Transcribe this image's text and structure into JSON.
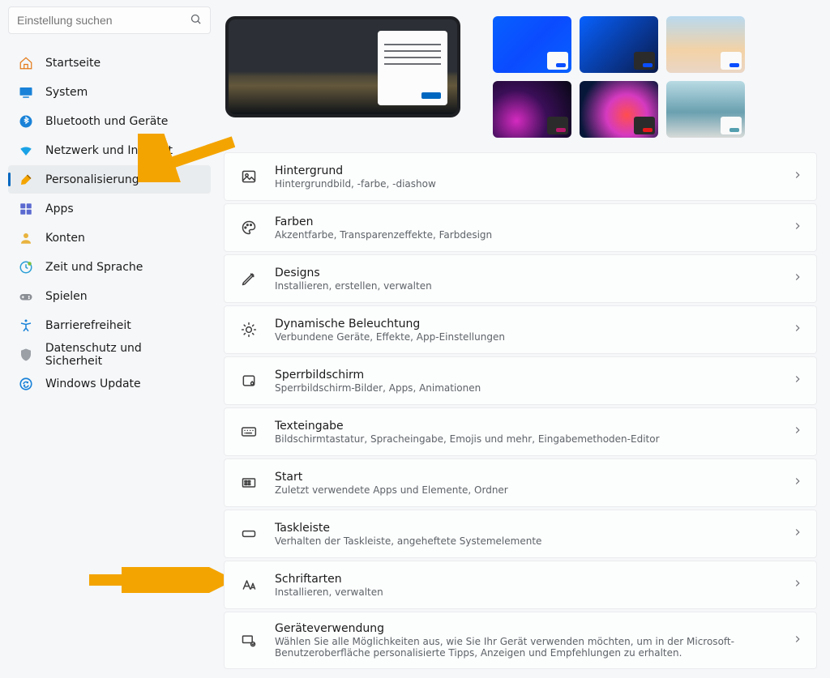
{
  "search": {
    "placeholder": "Einstellung suchen"
  },
  "nav": {
    "items": [
      {
        "label": "Startseite",
        "icon": "home"
      },
      {
        "label": "System",
        "icon": "system"
      },
      {
        "label": "Bluetooth und Geräte",
        "icon": "bluetooth"
      },
      {
        "label": "Netzwerk und Internet",
        "icon": "wifi"
      },
      {
        "label": "Personalisierung",
        "icon": "brush",
        "active": true
      },
      {
        "label": "Apps",
        "icon": "apps"
      },
      {
        "label": "Konten",
        "icon": "person"
      },
      {
        "label": "Zeit und Sprache",
        "icon": "clock"
      },
      {
        "label": "Spielen",
        "icon": "game"
      },
      {
        "label": "Barrierefreiheit",
        "icon": "a11y"
      },
      {
        "label": "Datenschutz und Sicherheit",
        "icon": "shield"
      },
      {
        "label": "Windows Update",
        "icon": "update"
      }
    ]
  },
  "cards": [
    {
      "title": "Hintergrund",
      "sub": "Hintergrundbild, -farbe, -diashow",
      "icon": "picture"
    },
    {
      "title": "Farben",
      "sub": "Akzentfarbe, Transparenzeffekte, Farbdesign",
      "icon": "palette"
    },
    {
      "title": "Designs",
      "sub": "Installieren, erstellen, verwalten",
      "icon": "pen"
    },
    {
      "title": "Dynamische Beleuchtung",
      "sub": "Verbundene Geräte, Effekte, App-Einstellungen",
      "icon": "light"
    },
    {
      "title": "Sperrbildschirm",
      "sub": "Sperrbildschirm-Bilder, Apps, Animationen",
      "icon": "lock"
    },
    {
      "title": "Texteingabe",
      "sub": "Bildschirmtastatur, Spracheingabe, Emojis und mehr, Eingabemethoden-Editor",
      "icon": "keyboard"
    },
    {
      "title": "Start",
      "sub": "Zuletzt verwendete Apps und Elemente, Ordner",
      "icon": "start"
    },
    {
      "title": "Taskleiste",
      "sub": "Verhalten der Taskleiste, angeheftete Systemelemente",
      "icon": "taskbar"
    },
    {
      "title": "Schriftarten",
      "sub": "Installieren, verwalten",
      "icon": "fonts"
    },
    {
      "title": "Geräteverwendung",
      "sub": "Wählen Sie alle Möglichkeiten aus, wie Sie Ihr Gerät verwenden möchten, um in der Microsoft-Benutzeroberfläche personalisierte Tipps, Anzeigen und Empfehlungen zu erhalten.",
      "icon": "device"
    }
  ],
  "thumbs": [
    {
      "bg": "linear-gradient(135deg,#0761ff 0%, #0b4bff 50%, #0761ff 100%)",
      "accent": "#0a4eff"
    },
    {
      "bg": "linear-gradient(135deg,#0761ff 0%, #0a1a4a 100%)",
      "accent": "#0a4eff",
      "dark": true
    },
    {
      "bg": "linear-gradient(180deg,#b9d9ef 0%, #f3d2a6 60%, #ead6c6 100%)",
      "accent": "#0a4eff"
    },
    {
      "bg": "radial-gradient(circle at 30% 70%, #d52bc0 0%, #3a0e57 45%, #070715 100%)",
      "accent": "#b5196a",
      "dark": true
    },
    {
      "bg": "radial-gradient(circle at 60% 60%, #ff4e4e 0%, #d63ac0 35%, #071739 80%)",
      "accent": "#e41a1a",
      "dark": true
    },
    {
      "bg": "linear-gradient(180deg,#b9dbe4 0%, #6aa0b0 55%, #d8dbd9 100%)",
      "accent": "#549faf"
    }
  ]
}
